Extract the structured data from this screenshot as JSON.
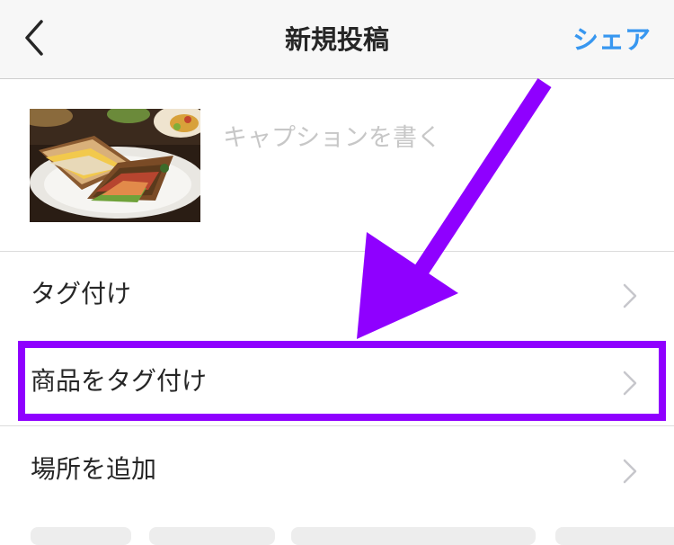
{
  "nav": {
    "title": "新規投稿",
    "share_label": "シェア",
    "back_icon": "chevron-left-icon"
  },
  "composer": {
    "caption_placeholder": "キャプションを書く",
    "thumbnail_icon": "sandwich-photo"
  },
  "options": [
    {
      "label": "タグ付け",
      "icon": "chevron-right-icon"
    },
    {
      "label": "商品をタグ付け",
      "icon": "chevron-right-icon",
      "highlighted": true
    },
    {
      "label": "場所を追加",
      "icon": "chevron-right-icon"
    }
  ],
  "colors": {
    "accent": "#3897f0",
    "placeholder": "#c7c7c7",
    "annotation": "#8f00ff",
    "chevron": "#c7c7cc"
  }
}
